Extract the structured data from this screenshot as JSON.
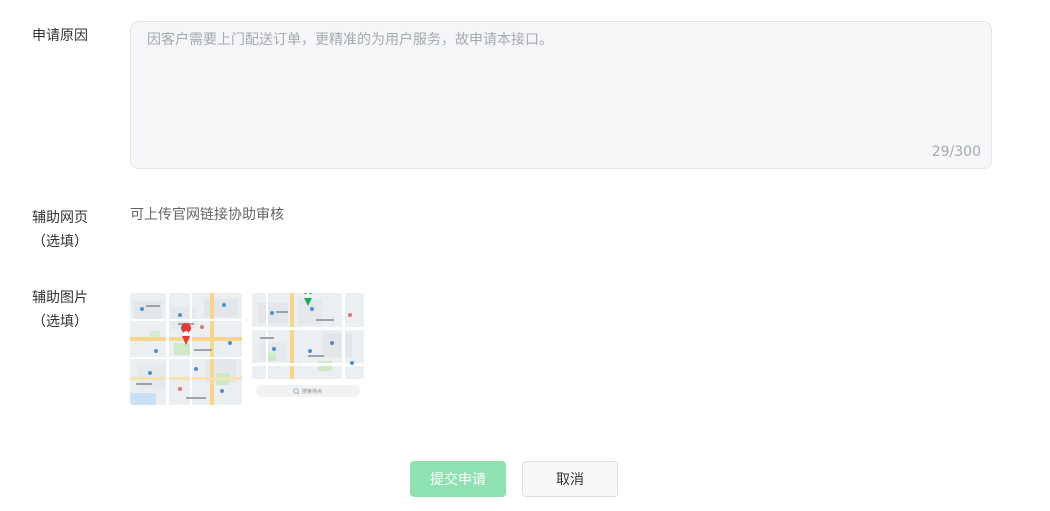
{
  "form": {
    "reason": {
      "label": "申请原因",
      "value": "因客户需要上门配送订单，更精准的为用户服务，故申请本接口。",
      "counter": "29/300"
    },
    "aux_web": {
      "label_main": "辅助网页",
      "label_sub": "（选填）",
      "hint": "可上传官网链接协助审核"
    },
    "aux_images": {
      "label_main": "辅助图片",
      "label_sub": "（选填）",
      "images": [
        {
          "type": "map-screenshot-1"
        },
        {
          "type": "map-screenshot-2",
          "search_text": "搜索地点"
        }
      ]
    }
  },
  "actions": {
    "submit_label": "提交申请",
    "cancel_label": "取消"
  },
  "colors": {
    "submit_bg": "#8ee2b1",
    "box_bg": "#f5f6f8",
    "placeholder": "#a6a9ae"
  }
}
